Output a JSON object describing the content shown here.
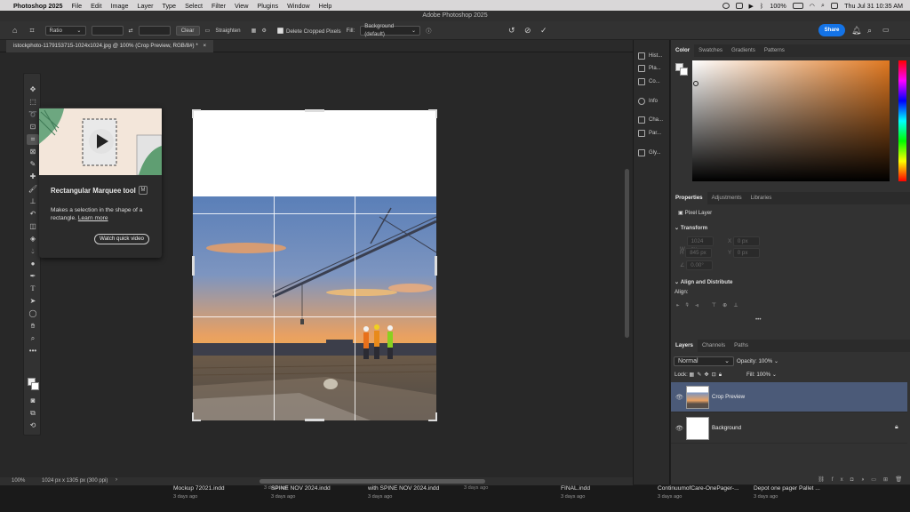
{
  "menubar": {
    "apple_icon": "apple-icon",
    "app_name": "Photoshop 2025",
    "items": [
      "File",
      "Edit",
      "Image",
      "Layer",
      "Type",
      "Select",
      "Filter",
      "View",
      "Plugins",
      "Window",
      "Help"
    ],
    "battery": "100%",
    "datetime": "Thu Jul 31  10:35 AM"
  },
  "window_title": "Adobe Photoshop 2025",
  "options_bar": {
    "ratio_label": "Ratio",
    "clear_label": "Clear",
    "straighten_label": "Straighten",
    "delete_cropped_label": "Delete Cropped Pixels",
    "fill_label": "Fill:",
    "fill_value": "Background (default)",
    "share_label": "Share"
  },
  "doc_tab": "istockphoto-1179153715-1024x1024.jpg @ 100% (Crop Preview, RGB/8#) *",
  "tooltip": {
    "title": "Rectangular Marquee tool",
    "shortcut": "M",
    "description": "Makes a selection in the shape of a rectangle.",
    "learn_more": "Learn more",
    "watch_video": "Watch quick video"
  },
  "right_strip": {
    "items": [
      "Hist...",
      "Pla...",
      "Co...",
      "Info",
      "Cha...",
      "Par...",
      "Gly..."
    ]
  },
  "color_panel": {
    "tabs": [
      "Color",
      "Swatches",
      "Gradients",
      "Patterns"
    ]
  },
  "properties_panel": {
    "tabs": [
      "Properties",
      "Adjustments",
      "Libraries"
    ],
    "pixel_layer": "Pixel Layer",
    "transform": "Transform",
    "w_label": "W",
    "w_value": "1024 px",
    "x_label": "X",
    "x_value": "0 px",
    "h_label": "H",
    "h_value": "845 px",
    "y_label": "Y",
    "y_value": "0 px",
    "angle_value": "0.00°",
    "align_distribute": "Align and Distribute",
    "align_label": "Align:"
  },
  "layers_panel": {
    "tabs": [
      "Layers",
      "Channels",
      "Paths"
    ],
    "blend_mode": "Normal",
    "opacity_label": "Opacity:",
    "opacity_value": "100%",
    "lock_label": "Lock:",
    "fill_label": "Fill:",
    "fill_value": "100%",
    "layers": [
      {
        "name": "Crop Preview",
        "selected": true
      },
      {
        "name": "Background",
        "selected": false
      }
    ]
  },
  "status_bar": {
    "zoom": "100%",
    "doc_info": "1024 px x 1305 px (300 ppi)"
  },
  "dock_files": [
    {
      "name": "Mockup 72021.indd",
      "date": "3 days ago"
    },
    {
      "name": "SPINE NOV 2024.indd",
      "date": "3 days ago"
    },
    {
      "name": "with SPINE NOV 2024.indd",
      "date": "3 days ago"
    },
    {
      "name": "FINAL.indd",
      "date": "3 days ago"
    },
    {
      "name": "ContinuumofCare-OnePager-...",
      "date": "3 days ago"
    },
    {
      "name": "Depot one pager Pallet ...",
      "date": "3 days ago"
    }
  ],
  "dock_small_dates": [
    "3 days ago",
    "3 days ago"
  ],
  "colors": {
    "accent": "#1473e6",
    "selected_layer": "#4b5a78",
    "panel_bg": "#323232"
  }
}
